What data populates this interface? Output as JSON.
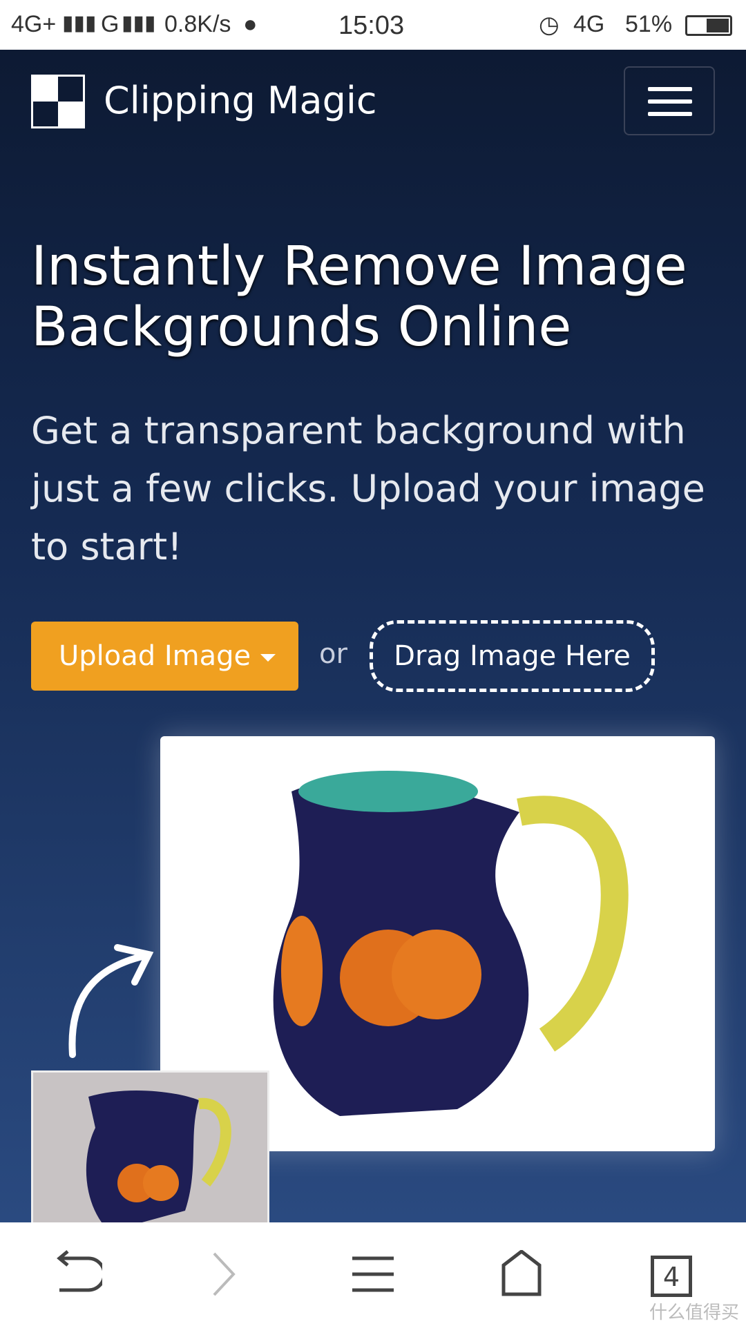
{
  "status": {
    "network1": "4G+",
    "network2": "G",
    "speed": "0.8K/s",
    "time": "15:03",
    "network3": "4G",
    "battery": "51%",
    "battery_level": 0.51
  },
  "header": {
    "brand": "Clipping Magic"
  },
  "hero": {
    "title": "Instantly Remove Image Backgrounds Online",
    "subtitle": "Get a transparent background with just a few clicks. Upload your image to start!",
    "upload_label": "Upload Image",
    "or_label": "or",
    "drag_label": "Drag Image Here"
  },
  "bottom_bar": {
    "tabs_count": "4",
    "watermark": "什么值得买"
  },
  "colors": {
    "accent": "#f0a020",
    "bg": "#0d1a33"
  }
}
